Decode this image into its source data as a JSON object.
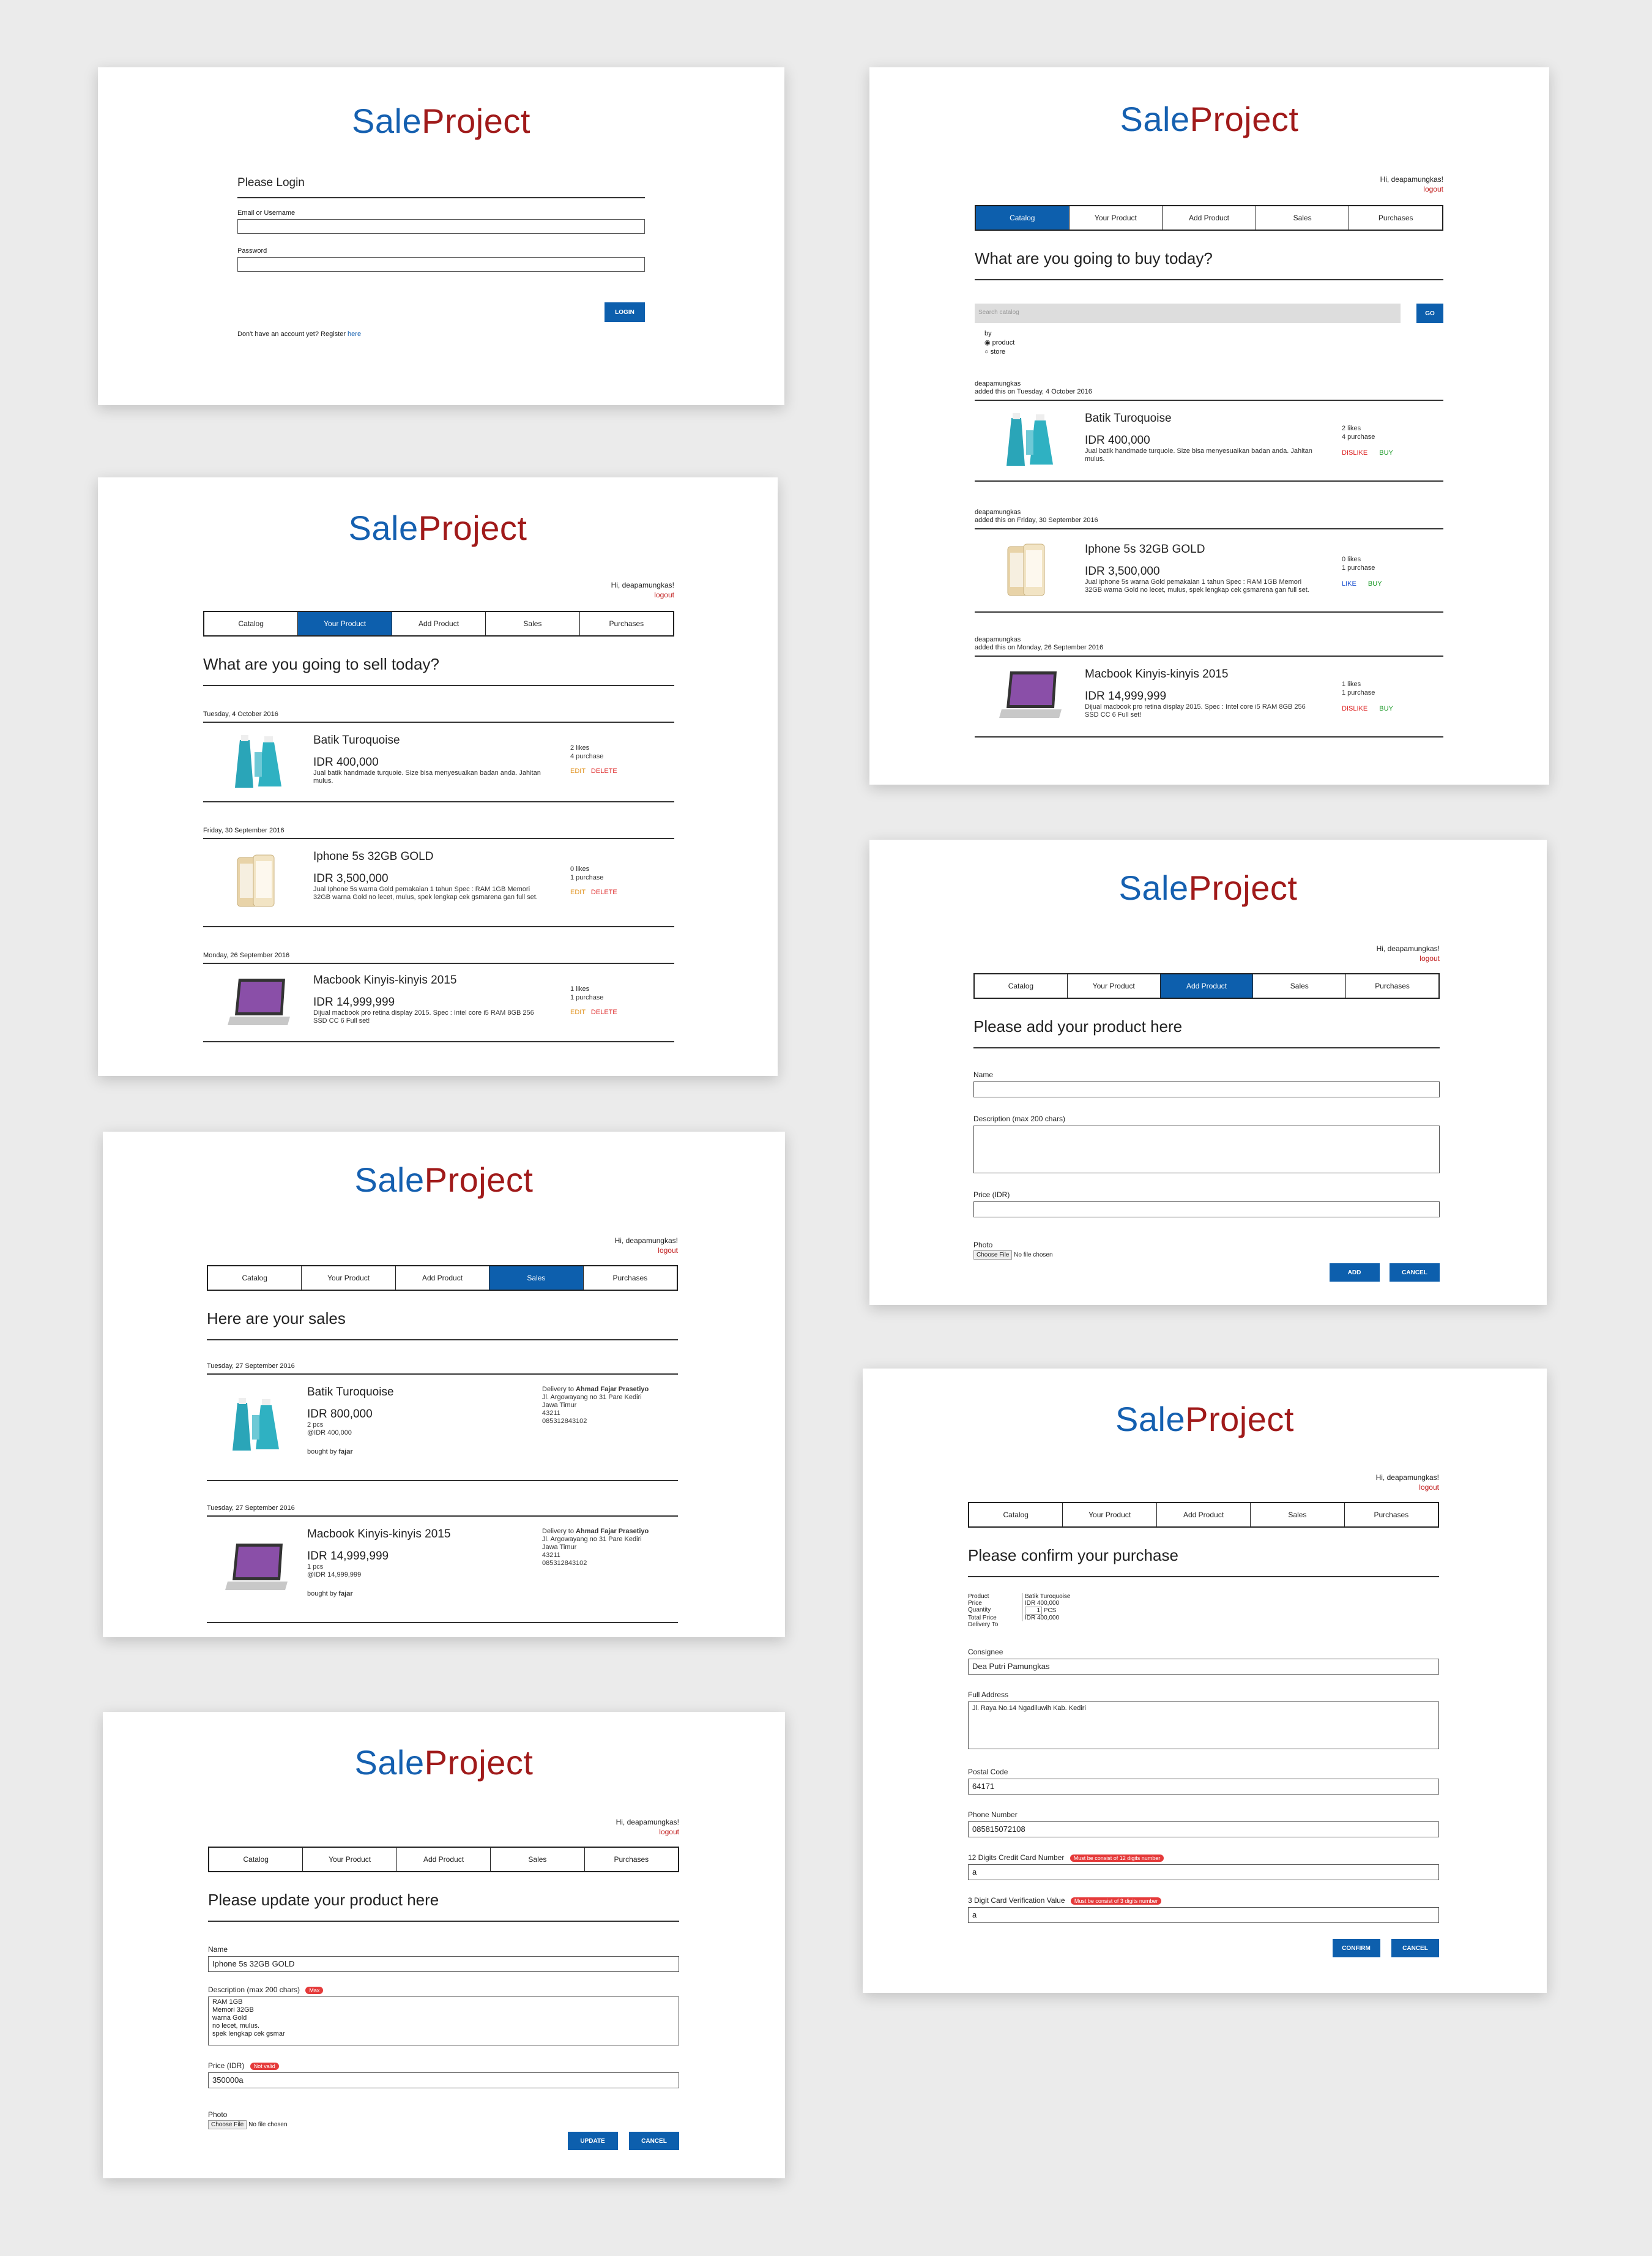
{
  "brand": {
    "sale": "Sale",
    "project": "Project"
  },
  "user": {
    "greeting": "Hi, deapamungkas!",
    "logout": "logout"
  },
  "tabs": [
    "Catalog",
    "Your Product",
    "Add Product",
    "Sales",
    "Purchases"
  ],
  "login": {
    "heading": "Please Login",
    "email_label": "Email or Username",
    "password_label": "Password",
    "button": "LOGIN",
    "register_text": "Don't have an account yet? Register",
    "register_link": "here"
  },
  "catalog": {
    "heading": "What are you going to buy today?",
    "search_placeholder": "Search catalog",
    "go": "GO",
    "by": "by",
    "opt_product": "product",
    "opt_store": "store",
    "items": [
      {
        "seller": "deapamungkas",
        "added": "added this on Tuesday, 4 October 2016",
        "name": "Batik Turoquoise",
        "price": "IDR 400,000",
        "desc": "Jual batik handmade turquoie. Size bisa menyesuaikan badan anda. Jahitan mulus.",
        "likes": "2 likes",
        "purchases": "4 purchase",
        "like": "DISLIKE",
        "buy": "BUY",
        "like_color": "red"
      },
      {
        "seller": "deapamungkas",
        "added": "added this on Friday, 30 September 2016",
        "name": "Iphone 5s 32GB GOLD",
        "price": "IDR 3,500,000",
        "desc": "Jual Iphone 5s warna Gold pemakaian 1 tahun Spec : RAM 1GB Memori 32GB warna Gold no lecet, mulus, spek lengkap cek gsmarena gan full set.",
        "likes": "0 likes",
        "purchases": "1 purchase",
        "like": "LIKE",
        "buy": "BUY",
        "like_color": "blue"
      },
      {
        "seller": "deapamungkas",
        "added": "added this on Monday, 26 September 2016",
        "name": "Macbook Kinyis-kinyis 2015",
        "price": "IDR 14,999,999",
        "desc": "Dijual macbook pro retina display 2015. Spec : Intel core i5 RAM 8GB 256 SSD CC 6 Full set!",
        "likes": "1 likes",
        "purchases": "1 purchase",
        "like": "DISLIKE",
        "buy": "BUY",
        "like_color": "red"
      }
    ]
  },
  "your_product": {
    "heading": "What are you going to sell today?",
    "edit": "EDIT",
    "delete": "DELETE",
    "items": [
      {
        "date": "Tuesday, 4 October 2016",
        "name": "Batik Turoquoise",
        "price": "IDR 400,000",
        "desc": "Jual batik handmade turquoie. Size bisa menyesuaikan badan anda. Jahitan mulus.",
        "likes": "2 likes",
        "purchases": "4 purchase"
      },
      {
        "date": "Friday, 30 September 2016",
        "name": "Iphone 5s 32GB GOLD",
        "price": "IDR 3,500,000",
        "desc": "Jual Iphone 5s warna Gold pemakaian 1 tahun Spec : RAM 1GB Memori 32GB warna Gold no lecet, mulus, spek lengkap cek gsmarena gan full set.",
        "likes": "0 likes",
        "purchases": "1 purchase"
      },
      {
        "date": "Monday, 26 September 2016",
        "name": "Macbook Kinyis-kinyis 2015",
        "price": "IDR 14,999,999",
        "desc": "Dijual macbook pro retina display 2015. Spec : Intel core i5 RAM 8GB 256 SSD CC 6 Full set!",
        "likes": "1 likes",
        "purchases": "1 purchase"
      }
    ]
  },
  "add_product": {
    "heading": "Please add your product here",
    "name_label": "Name",
    "desc_label": "Description (max 200 chars)",
    "price_label": "Price (IDR)",
    "photo_label": "Photo",
    "choose_file": "Choose File",
    "no_file": "No file chosen",
    "add": "ADD",
    "cancel": "CANCEL"
  },
  "sales": {
    "heading": "Here are your sales",
    "items": [
      {
        "date": "Tuesday, 27 September 2016",
        "name": "Batik Turoquoise",
        "price": "IDR 800,000",
        "qty": "2 pcs",
        "unit": "@IDR 400,000",
        "bought_by": "bought by",
        "buyer": "fajar",
        "delivery_to": "Delivery to",
        "recipient": "Ahmad Fajar Prasetiyo",
        "addr1": "Jl. Argowayang no 31 Pare Kediri",
        "addr2": "Jawa Timur",
        "postal": "43211",
        "phone": "085312843102"
      },
      {
        "date": "Tuesday, 27 September 2016",
        "name": "Macbook Kinyis-kinyis 2015",
        "price": "IDR 14,999,999",
        "qty": "1 pcs",
        "unit": "@IDR 14,999,999",
        "bought_by": "bought by",
        "buyer": "fajar",
        "delivery_to": "Delivery to",
        "recipient": "Ahmad Fajar Prasetiyo",
        "addr1": "Jl. Argowayang no 31 Pare Kediri",
        "addr2": "Jawa Timur",
        "postal": "43211",
        "phone": "085312843102"
      }
    ]
  },
  "confirm": {
    "heading": "Please confirm your purchase",
    "product_label": "Product",
    "product_value": "Batik Turoquoise",
    "price_label": "Price",
    "price_value": "IDR 400,000",
    "qty_label": "Quantity",
    "qty_value": "1",
    "qty_unit": "PCS",
    "total_label": "Total Price",
    "total_value": "IDR 400,000",
    "delivery_label": "Delivery To",
    "consignee_label": "Consignee",
    "consignee_value": "Dea Putri Pamungkas",
    "address_label": "Full Address",
    "address_value": "Jl. Raya No.14 Ngadiluwih Kab. Kediri",
    "postal_label": "Postal Code",
    "postal_value": "64171",
    "phone_label": "Phone Number",
    "phone_value": "085815072108",
    "card_label": "12 Digits Credit Card Number",
    "card_error": "Must be consist of 12 digits number",
    "card_value": "a",
    "cvv_label": "3 Digit Card Verification Value",
    "cvv_error": "Must be consist of 3 digits number",
    "cvv_value": "a",
    "confirm": "CONFIRM",
    "cancel": "CANCEL"
  },
  "update": {
    "heading": "Please update your product here",
    "name_label": "Name",
    "name_value": "Iphone 5s 32GB GOLD",
    "desc_label": "Description (max 200 chars)",
    "desc_error": "Max",
    "desc_value": "RAM 1GB\nMemori 32GB\nwarna Gold\nno lecet, mulus.\nspek lengkap cek gsmar",
    "price_label": "Price (IDR)",
    "price_error": "Not valid",
    "price_value": "350000a",
    "photo_label": "Photo",
    "choose_file": "Choose File",
    "no_file": "No file chosen",
    "update": "UPDATE",
    "cancel": "CANCEL"
  },
  "colors": {
    "accent": "#0d5fad",
    "brand_red": "#a01a1a",
    "danger": "#e53a3a",
    "background": "#ebebeb"
  }
}
